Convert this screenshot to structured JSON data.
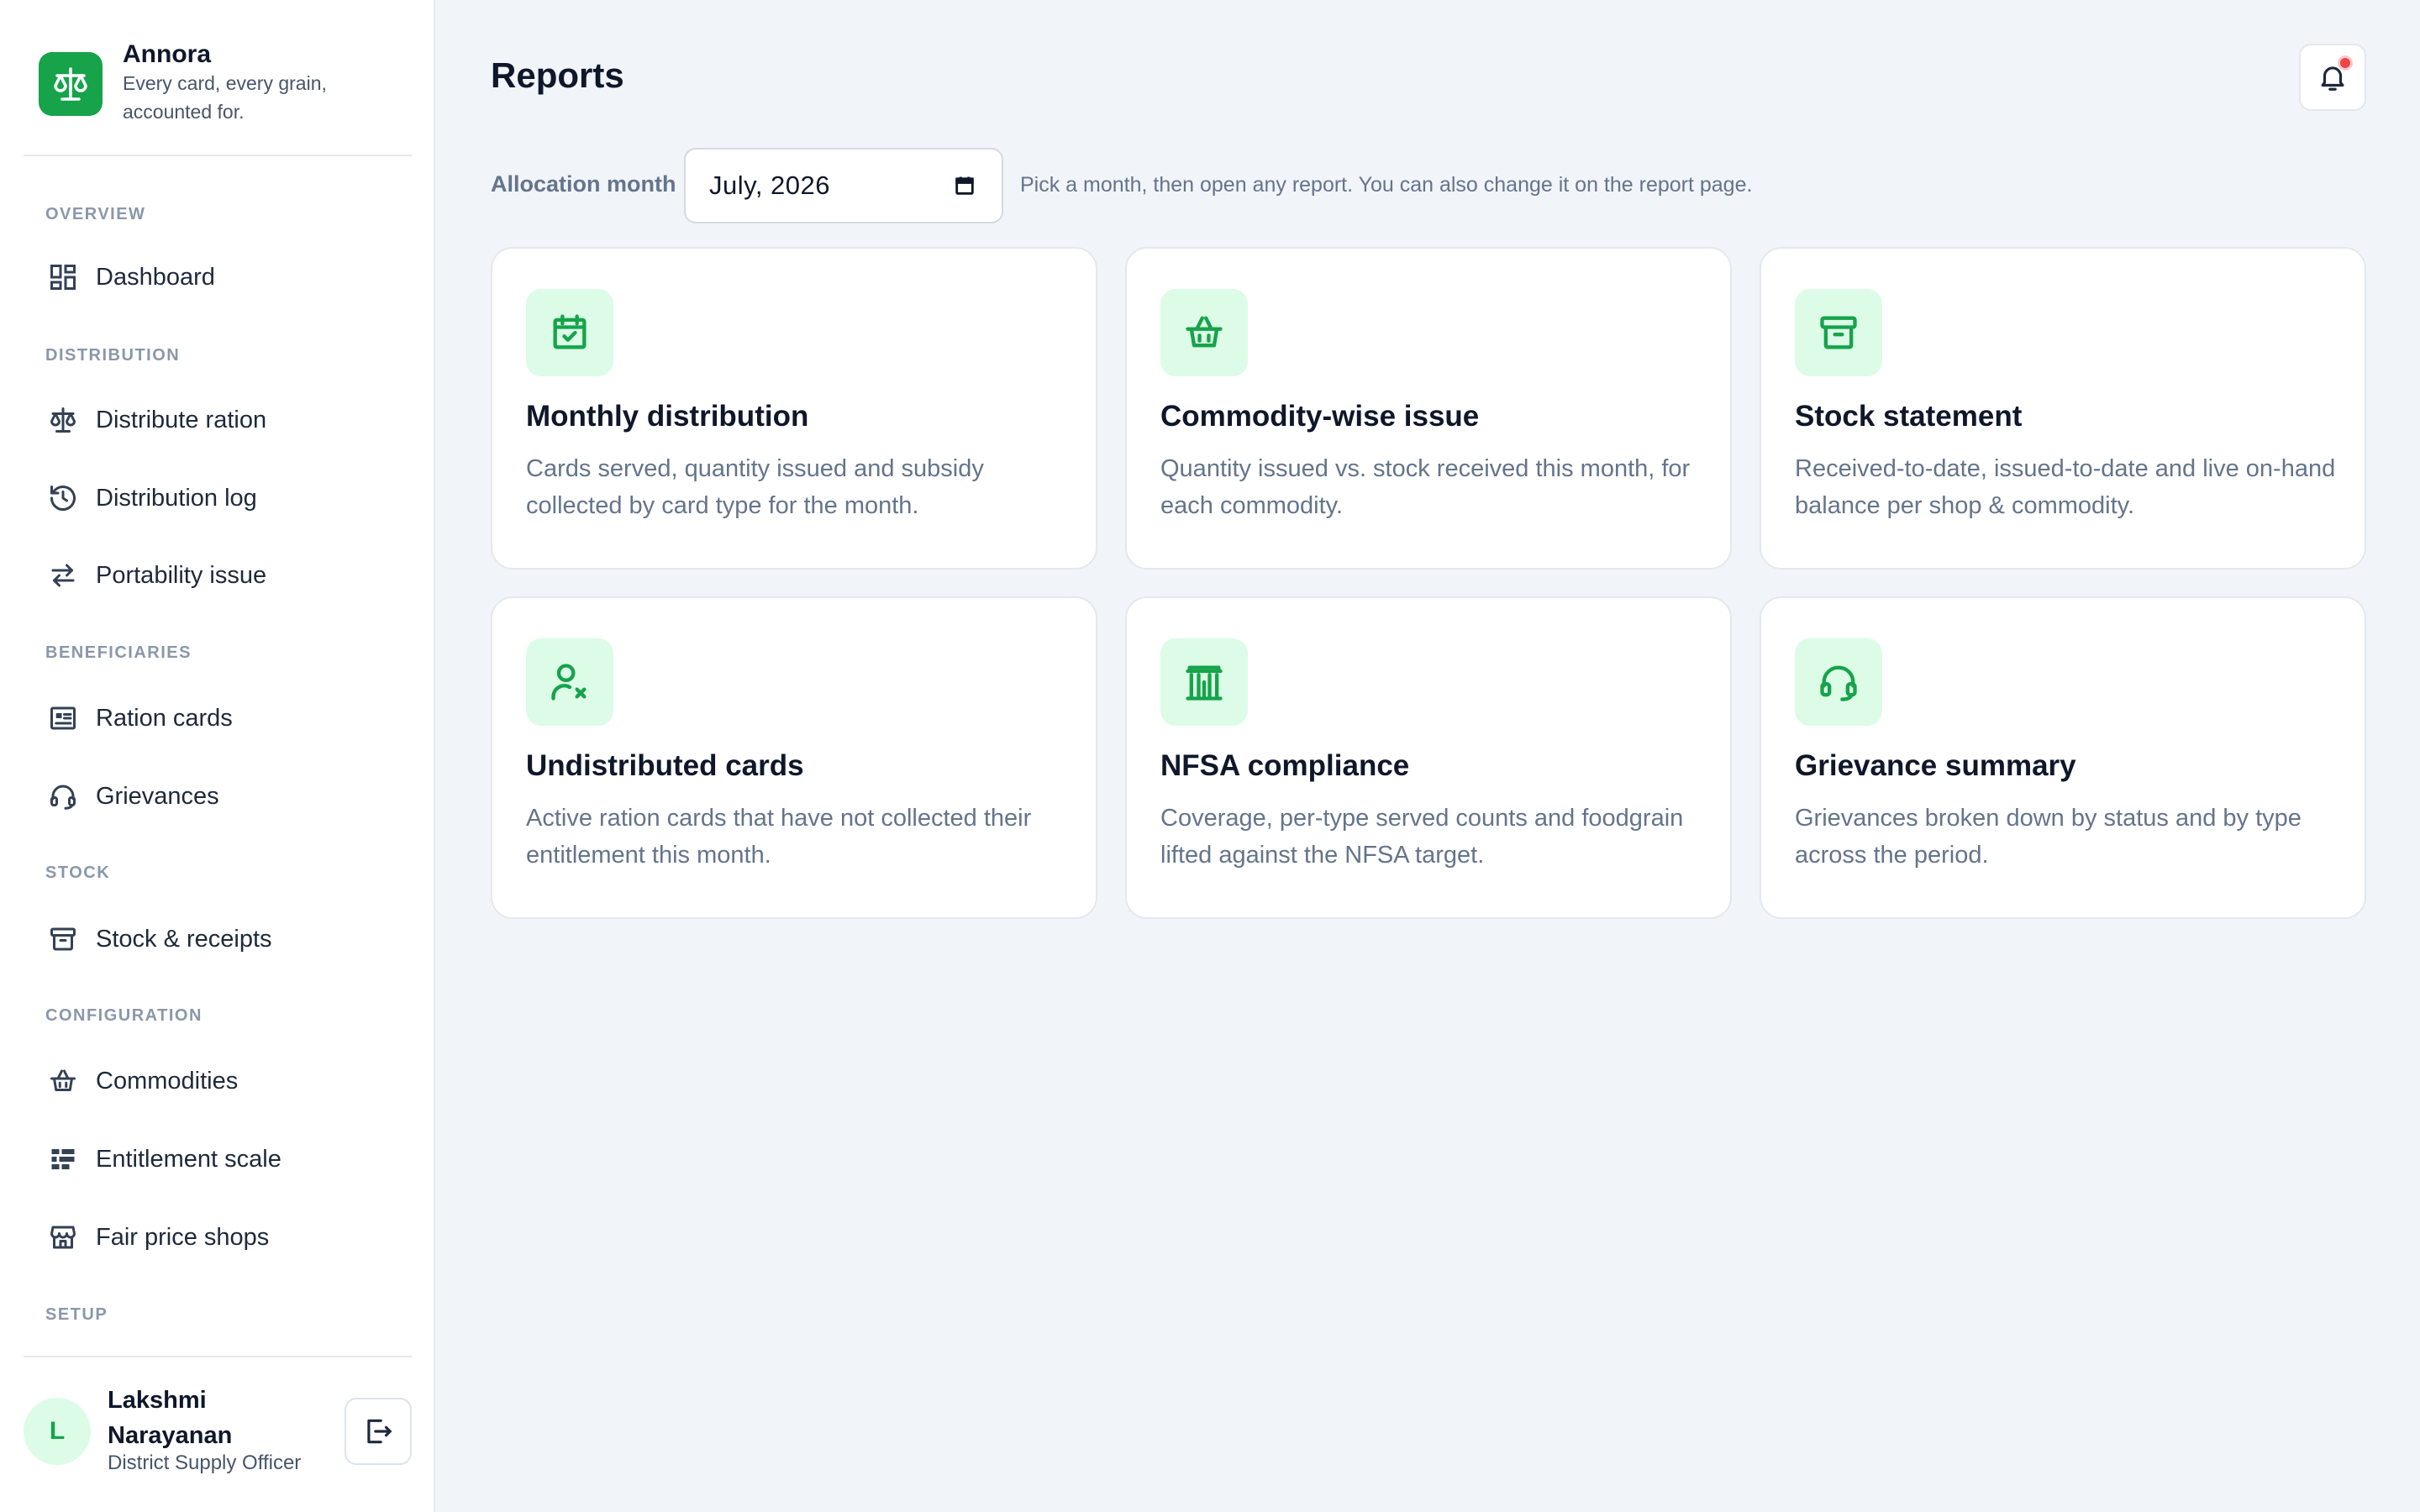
{
  "brand": {
    "name": "Annora",
    "tagline": "Every card, every grain, accounted for."
  },
  "sidebar": {
    "sections": {
      "overview": "OVERVIEW",
      "distribution": "DISTRIBUTION",
      "beneficiaries": "BENEFICIARIES",
      "stock": "STOCK",
      "configuration": "CONFIGURATION",
      "setup": "SETUP"
    },
    "items": [
      {
        "label": "Dashboard",
        "icon": "dashboard-icon"
      },
      {
        "label": "Distribute ration",
        "icon": "scale-icon"
      },
      {
        "label": "Distribution log",
        "icon": "history-icon"
      },
      {
        "label": "Portability issue",
        "icon": "swap-arrows-icon"
      },
      {
        "label": "Ration cards",
        "icon": "card-icon"
      },
      {
        "label": "Grievances",
        "icon": "headset-icon"
      },
      {
        "label": "Stock & receipts",
        "icon": "archive-box-icon"
      },
      {
        "label": "Commodities",
        "icon": "basket-icon"
      },
      {
        "label": "Entitlement scale",
        "icon": "list-bars-icon"
      },
      {
        "label": "Fair price shops",
        "icon": "storefront-icon"
      }
    ]
  },
  "user": {
    "initial": "L",
    "name": "Lakshmi Narayanan",
    "role": "District Supply Officer"
  },
  "main": {
    "title": "Reports",
    "month_label": "Allocation month",
    "month_value": "July, 2026",
    "month_hint": "Pick a month, then open any report. You can also change it on the report page."
  },
  "reports": [
    {
      "title": "Monthly distribution",
      "desc": "Cards served, quantity issued and subsidy collected by card type for the month.",
      "icon": "calendar-check-icon"
    },
    {
      "title": "Commodity-wise issue",
      "desc": "Quantity issued vs. stock received this month, for each commodity.",
      "icon": "basket-icon"
    },
    {
      "title": "Stock statement",
      "desc": "Received-to-date, issued-to-date and live on-hand balance per shop & commodity.",
      "icon": "archive-box-icon"
    },
    {
      "title": "Undistributed cards",
      "desc": "Active ration cards that have not collected their entitlement this month.",
      "icon": "user-x-icon"
    },
    {
      "title": "NFSA compliance",
      "desc": "Coverage, per-type served counts and foodgrain lifted against the NFSA target.",
      "icon": "building-columns-icon"
    },
    {
      "title": "Grievance summary",
      "desc": "Grievances broken down by status and by type across the period.",
      "icon": "headset-icon"
    }
  ],
  "colors": {
    "accent": "#16a34a",
    "accent_soft": "#dcfce7",
    "notification": "#ef4444"
  }
}
